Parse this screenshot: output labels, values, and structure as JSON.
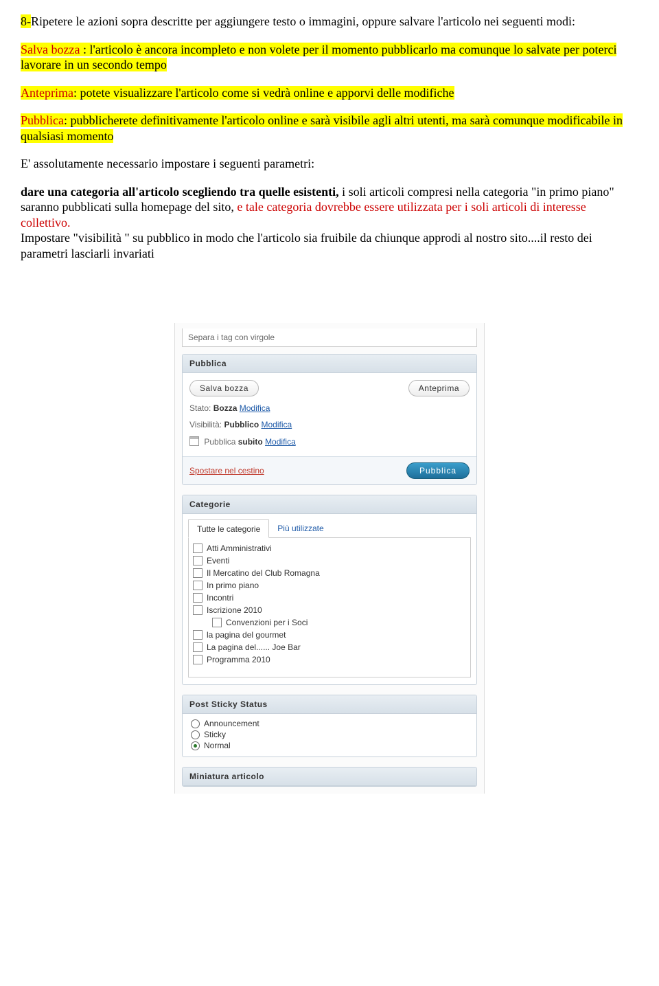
{
  "doc": {
    "p1a": "8-",
    "p1b": "Ripetere le azioni sopra descritte per aggiungere testo o immagini, oppure  salvare l'articolo nei seguenti modi:",
    "p2_label": "Salva bozza",
    "p2_sep": " : ",
    "p2_text": "l'articolo è ancora incompleto e non volete per il momento pubblicarlo ma comunque lo salvate per poterci lavorare in un secondo tempo",
    "p3_label": "Anteprima",
    "p3_sep": ": ",
    "p3_text": "potete visualizzare l'articolo come si vedrà online e apporvi delle modifiche",
    "p4_label": "Pubblica",
    "p4_sep": ": ",
    "p4_text": "pubblicherete definitivamente l'articolo online e sarà visibile agli altri utenti, ma sarà comunque modificabile in qualsiasi momento",
    "p5": "E' assolutamente necessario impostare i seguenti parametri:",
    "p6_bold": "dare una categoria all'articolo scegliendo tra quelle esistenti, ",
    "p6_plain": "i soli articoli compresi nella categoria \"in primo piano\" saranno pubblicati sulla homepage del sito, ",
    "p6_red": "e tale categoria dovrebbe essere utilizzata per i soli articoli di interesse collettivo.",
    "p7": "Impostare \"visibilità \" su pubblico in modo che l'articolo sia fruibile da chiunque approdi al nostro sito....il resto dei parametri lasciarli invariati"
  },
  "shot": {
    "tag_hint": "Separa i tag con virgole",
    "publish_box": {
      "title": "Pubblica",
      "btn_draft": "Salva bozza",
      "btn_preview": "Anteprima",
      "status_lbl": "Stato:",
      "status_val": "Bozza",
      "vis_lbl": "Visibilità:",
      "vis_val": "Pubblico",
      "sched_prefix": "Pubblica",
      "sched_val": "subito",
      "edit": "Modifica",
      "trash": "Spostare nel cestino",
      "btn_publish": "Pubblica"
    },
    "cat_box": {
      "title": "Categorie",
      "tab_all": "Tutte le categorie",
      "tab_pop": "Più utilizzate",
      "items": [
        {
          "label": "Atti Amministrativi",
          "indent": false
        },
        {
          "label": "Eventi",
          "indent": false
        },
        {
          "label": "Il Mercatino del Club Romagna",
          "indent": false
        },
        {
          "label": "In primo piano",
          "indent": false
        },
        {
          "label": "Incontri",
          "indent": false
        },
        {
          "label": "Iscrizione 2010",
          "indent": false
        },
        {
          "label": "Convenzioni per i Soci",
          "indent": true
        },
        {
          "label": "la pagina del gourmet",
          "indent": false
        },
        {
          "label": "La pagina del...... Joe Bar",
          "indent": false
        },
        {
          "label": "Programma 2010",
          "indent": false
        }
      ]
    },
    "sticky_box": {
      "title": "Post Sticky Status",
      "options": [
        {
          "label": "Announcement",
          "selected": false
        },
        {
          "label": "Sticky",
          "selected": false
        },
        {
          "label": "Normal",
          "selected": true
        }
      ]
    },
    "thumb_box": {
      "title": "Miniatura articolo"
    }
  }
}
